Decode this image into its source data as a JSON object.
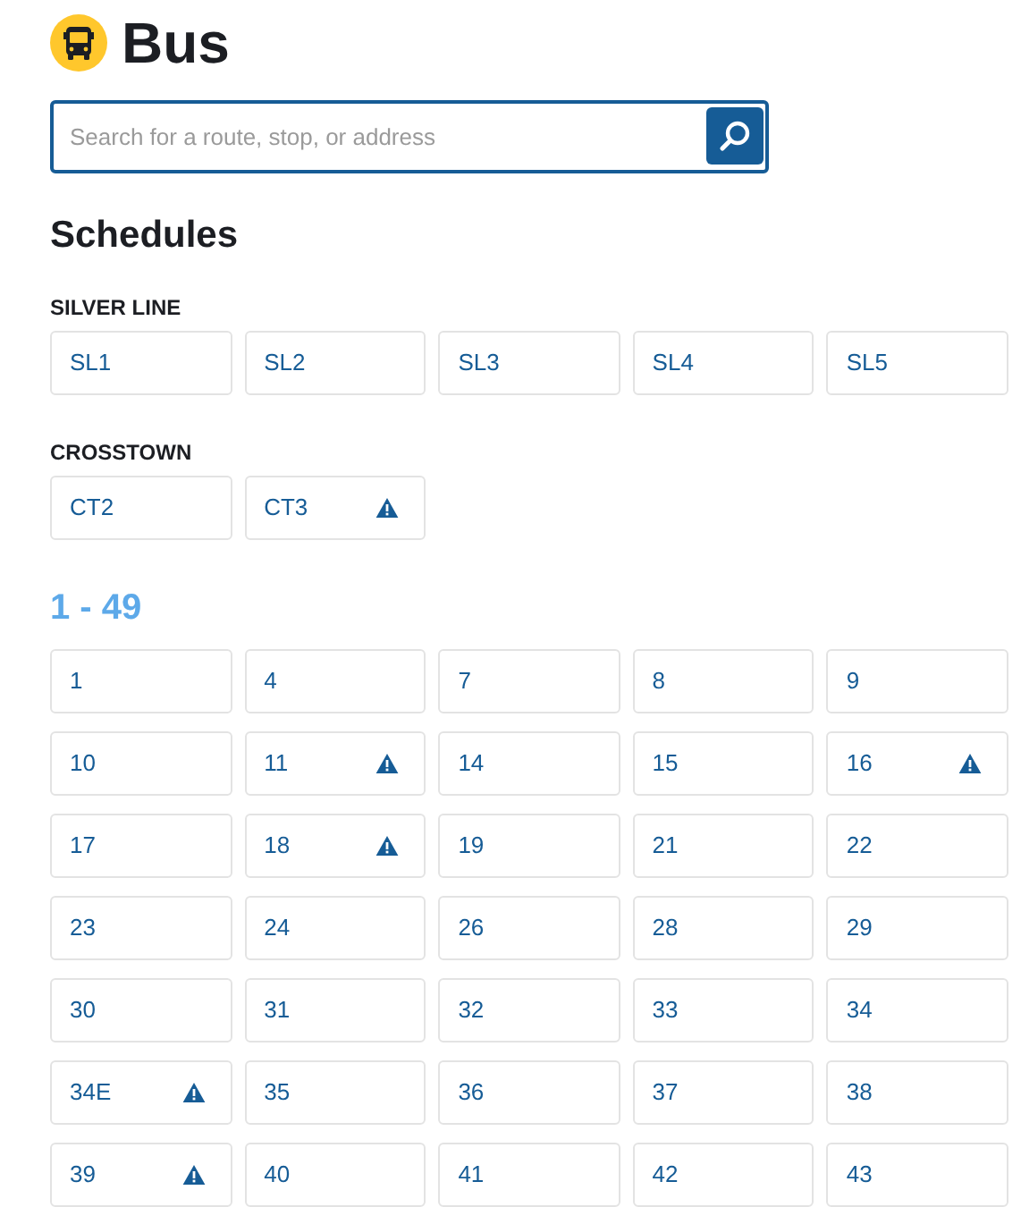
{
  "page": {
    "title": "Bus"
  },
  "search": {
    "placeholder": "Search for a route, stop, or address"
  },
  "schedules": {
    "title": "Schedules",
    "groups": [
      {
        "kind": "subhead",
        "title": "SILVER LINE",
        "routes": [
          {
            "name": "SL1",
            "alert": false
          },
          {
            "name": "SL2",
            "alert": false
          },
          {
            "name": "SL3",
            "alert": false
          },
          {
            "name": "SL4",
            "alert": false
          },
          {
            "name": "SL5",
            "alert": false
          }
        ]
      },
      {
        "kind": "subhead",
        "title": "CROSSTOWN",
        "routes": [
          {
            "name": "CT2",
            "alert": false
          },
          {
            "name": "CT3",
            "alert": true
          }
        ]
      },
      {
        "kind": "range",
        "title": "1 - 49",
        "routes": [
          {
            "name": "1",
            "alert": false
          },
          {
            "name": "4",
            "alert": false
          },
          {
            "name": "7",
            "alert": false
          },
          {
            "name": "8",
            "alert": false
          },
          {
            "name": "9",
            "alert": false
          },
          {
            "name": "10",
            "alert": false
          },
          {
            "name": "11",
            "alert": true
          },
          {
            "name": "14",
            "alert": false
          },
          {
            "name": "15",
            "alert": false
          },
          {
            "name": "16",
            "alert": true
          },
          {
            "name": "17",
            "alert": false
          },
          {
            "name": "18",
            "alert": true
          },
          {
            "name": "19",
            "alert": false
          },
          {
            "name": "21",
            "alert": false
          },
          {
            "name": "22",
            "alert": false
          },
          {
            "name": "23",
            "alert": false
          },
          {
            "name": "24",
            "alert": false
          },
          {
            "name": "26",
            "alert": false
          },
          {
            "name": "28",
            "alert": false
          },
          {
            "name": "29",
            "alert": false
          },
          {
            "name": "30",
            "alert": false
          },
          {
            "name": "31",
            "alert": false
          },
          {
            "name": "32",
            "alert": false
          },
          {
            "name": "33",
            "alert": false
          },
          {
            "name": "34",
            "alert": false
          },
          {
            "name": "34E",
            "alert": true
          },
          {
            "name": "35",
            "alert": false
          },
          {
            "name": "36",
            "alert": false
          },
          {
            "name": "37",
            "alert": false
          },
          {
            "name": "38",
            "alert": false
          },
          {
            "name": "39",
            "alert": true
          },
          {
            "name": "40",
            "alert": false
          },
          {
            "name": "41",
            "alert": false
          },
          {
            "name": "42",
            "alert": false
          },
          {
            "name": "43",
            "alert": false
          }
        ]
      }
    ]
  }
}
